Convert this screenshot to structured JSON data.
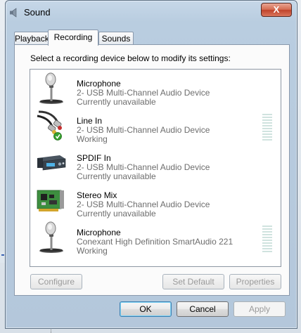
{
  "window": {
    "title": "Sound",
    "close_label": "X"
  },
  "tabs": [
    {
      "label": "Playback"
    },
    {
      "label": "Recording"
    },
    {
      "label": "Sounds"
    }
  ],
  "instructions": "Select a recording device below to modify its settings:",
  "devices": [
    {
      "name": "Microphone",
      "device": "2- USB Multi-Channel Audio Device",
      "status": "Currently unavailable",
      "icon": "microphone-icon",
      "default": false,
      "level_meter": false
    },
    {
      "name": "Line In",
      "device": "2- USB Multi-Channel Audio Device",
      "status": "Working",
      "icon": "line-in-cable-icon",
      "default": true,
      "level_meter": true
    },
    {
      "name": "SPDIF In",
      "device": "2- USB Multi-Channel Audio Device",
      "status": "Currently unavailable",
      "icon": "spdif-device-icon",
      "default": false,
      "level_meter": false
    },
    {
      "name": "Stereo Mix",
      "device": "2- USB Multi-Channel Audio Device",
      "status": "Currently unavailable",
      "icon": "sound-card-icon",
      "default": false,
      "level_meter": false
    },
    {
      "name": "Microphone",
      "device": "Conexant High Definition SmartAudio 221",
      "status": "Working",
      "icon": "microphone-icon",
      "default": false,
      "level_meter": true
    }
  ],
  "list_buttons": {
    "configure": "Configure",
    "set_default": "Set Default",
    "properties": "Properties"
  },
  "dialog_buttons": {
    "ok": "OK",
    "cancel": "Cancel",
    "apply": "Apply"
  },
  "colors": {
    "accent": "#3c7fb1",
    "check_green": "#37a12f",
    "meter_idle": "#d0e3df"
  }
}
